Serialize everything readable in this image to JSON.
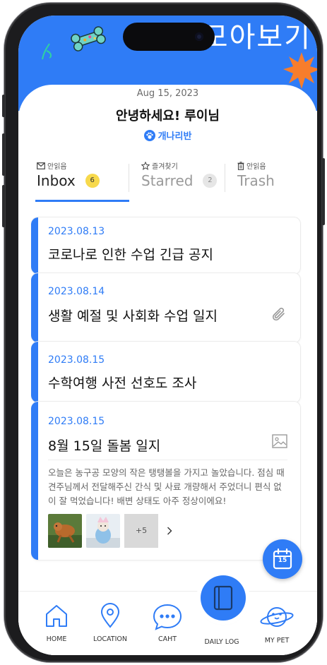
{
  "header": {
    "banner": "알림 모아보기",
    "date": "Aug 15, 2023",
    "greeting": "안녕하세요! 루이님",
    "class_name": "개나리반"
  },
  "tabs": [
    {
      "caption": "안읽음",
      "label": "Inbox",
      "count": "6",
      "active": true,
      "icon": "envelope-icon"
    },
    {
      "caption": "즐겨찾기",
      "label": "Starred",
      "count": "2",
      "active": false,
      "icon": "star-icon"
    },
    {
      "caption": "안읽음",
      "label": "Trash",
      "count": "",
      "active": false,
      "icon": "trash-icon"
    }
  ],
  "notices": [
    {
      "date": "2023.08.13",
      "title": "코로나로 인한 수업 긴급 공지"
    },
    {
      "date": "2023.08.14",
      "title": "생활 예절 및 사회화 수업 일지",
      "attachment": "paperclip-icon"
    },
    {
      "date": "2023.08.15",
      "title": "수학여행 사전 선호도 조사"
    },
    {
      "date": "2023.08.15",
      "title": "8월 15일 돌봄 일지",
      "attachment": "image-icon",
      "body": "오늘은 농구공  모양의 작은 탱탱볼을 가지고 놀았습니다. 점심 때 견주님께서 전달해주신 간식 및 사료 개량해서 주었더니 편식 없이 잘 먹었습니다! 배변 상태도 아주 정상이에요!",
      "more_photos": "+5"
    }
  ],
  "calendar_fab": {
    "day": "15"
  },
  "nav": [
    {
      "label": "HOME",
      "icon": "home-icon"
    },
    {
      "label": "LOCATION",
      "icon": "location-pin-icon"
    },
    {
      "label": "CAHT",
      "icon": "chat-bubble-icon"
    },
    {
      "label": "DAILY LOG",
      "icon": "notebook-icon"
    },
    {
      "label": "MY PET",
      "icon": "pet-planet-icon"
    }
  ],
  "colors": {
    "accent": "#2f7cf6",
    "badge_yellow": "#f7d94c"
  }
}
